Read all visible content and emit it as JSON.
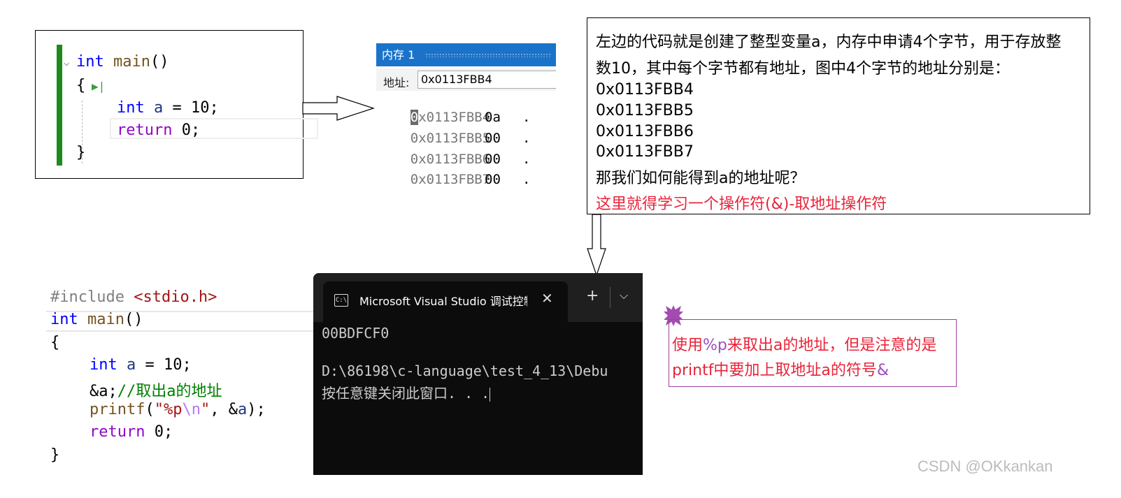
{
  "code_top": {
    "lines": [
      "int main()",
      "{",
      "int a = 10;",
      "return 0;",
      "}"
    ]
  },
  "memory_window": {
    "title": "内存 1",
    "address_label": "地址:",
    "address_value": "0x0113FBB4",
    "rows": [
      {
        "addr": "0x0113FBB4",
        "value": "0a",
        "char": "."
      },
      {
        "addr": "0x0113FBB5",
        "value": "00",
        "char": "."
      },
      {
        "addr": "0x0113FBB6",
        "value": "00",
        "char": "."
      },
      {
        "addr": "0x0113FBB7",
        "value": "00",
        "char": "."
      }
    ]
  },
  "explanation": {
    "line1": "左边的代码就是创建了整型变量a，内存中申请4个字节，用于存放整",
    "line2": "数10，其中每个字节都有地址，图中4个字节的地址分别是：",
    "addresses": [
      "0x0113FBB4",
      "0x0113FBB5",
      "0x0113FBB6",
      "0x0113FBB7"
    ],
    "question": "那我们如何能得到a的地址呢？",
    "highlight": "这里就得学习一个操作符(&)-取地址操作符"
  },
  "code_bottom": {
    "include": "#include",
    "header": "<stdio.h>",
    "main": "int main()",
    "open": "{",
    "decl": "int a = 10;",
    "addr_expr": "&a;",
    "comment": "//取出a的地址",
    "printf_line": "printf(\"%p\\n\", &a);",
    "ret": "return 0;",
    "close": "}"
  },
  "terminal": {
    "tab_title": "Microsoft Visual Studio 调试控制台",
    "output1": "00BDFCF0",
    "output2": "D:\\86198\\c-language\\test_4_13\\Debu",
    "output3": "按任意键关闭此窗口. . ."
  },
  "note": {
    "line1_a": "使用",
    "line1_p": "%p",
    "line1_b": "来取出a的地址，但是注意的是",
    "line2_a": "printf中要加上取地址a的符号",
    "line2_amp": "&"
  },
  "watermark": "CSDN @OKkankan",
  "colors": {
    "keyword": "#0000ff",
    "control": "#8f08c4",
    "memory_title": "#1a73c9",
    "highlight_red": "#e8243a",
    "note_border": "#a040a0",
    "gutter_green": "#1e8a1e"
  }
}
